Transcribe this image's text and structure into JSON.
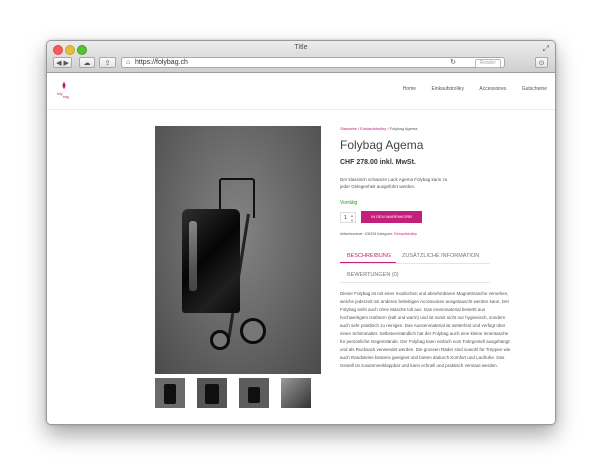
{
  "browser": {
    "title": "Title",
    "url": "https://folybag.ch",
    "reader_label": "Reader"
  },
  "site": {
    "logo_text": "foly bag",
    "nav": [
      "Home",
      "Einkaufstrolley",
      "Accessoires",
      "Gutscheine"
    ]
  },
  "product": {
    "breadcrumb": {
      "home": "Startseite",
      "category": "Einkaufstrolley",
      "current": "Folybag Agema"
    },
    "title": "Folybag Agema",
    "price": "CHF 278.00",
    "price_suffix": "inkl. MwSt.",
    "short_description": "Der klassisch schwarze Lack Agema Folybag kann zu jeder Gelegenheit ausgeführt werden.",
    "stock": "Vorrätig",
    "quantity": "1",
    "cart_button": "IN DEN WARENKORB",
    "meta": {
      "sku_label": "Artikelnummer:",
      "sku": "105293",
      "category_label": "Kategorie:",
      "category": "Einkaufstrolley"
    },
    "tabs": [
      "BESCHREIBUNG",
      "ZUSÄTZLICHE INFORMATION",
      "BEWERTUNGEN (0)"
    ],
    "long_description": "Dieser Folybag ist mit einer modischen und abnehmbaren Magnetmasche versehen, welche jederzeit mit anderen beliebigen Accessoires ausgetauscht werden kann. Der Folybag sieht auch ohne Masche toll aus. Das Innenmaterial besteht aus hochwertigem Isotherm (kalt und warm) und ist somit nicht nur hygienisch, sondern auch sehr praktisch zu reinigen. Das Aussenmaterial ist wetterfest und verfügt über einen Schimmalter. Selbstverständlich hat der Folybag auch eine kleine Innentasche für persönliche Gegenstände. Der Folybag kann einfach vom Fahrgestell ausgehängt und als Rucksack verwendet werden. Die grossen Räder sind sowohl für Treppen wie auch Randsteine bestens geeignet und bieten dadurch Komfort und Laufruhe. Das Gestell ist zusammenklappbar und kann schnell und praktisch verstaut werden."
  },
  "colors": {
    "accent": "#c41f7c",
    "stock": "#1aa31a"
  }
}
